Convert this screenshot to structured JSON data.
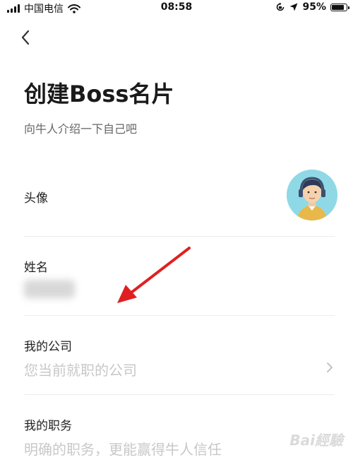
{
  "status_bar": {
    "carrier": "中国电信",
    "time": "08:58",
    "battery": "95%",
    "battery_level": 0.95
  },
  "header": {
    "back_icon": "chevron-left-icon",
    "title": "创建Boss名片",
    "subtitle": "向牛人介绍一下自己吧"
  },
  "form": {
    "avatar_label": "头像",
    "name_label": "姓名",
    "company_label": "我的公司",
    "company_placeholder": "您当前就职的公司",
    "position_label": "我的职务",
    "position_placeholder": "明确的职务，更能赢得牛人信任"
  },
  "watermark": "Bai經驗",
  "colors": {
    "annotation_arrow": "#e02020",
    "avatar_bg": "#8fd9e6"
  }
}
